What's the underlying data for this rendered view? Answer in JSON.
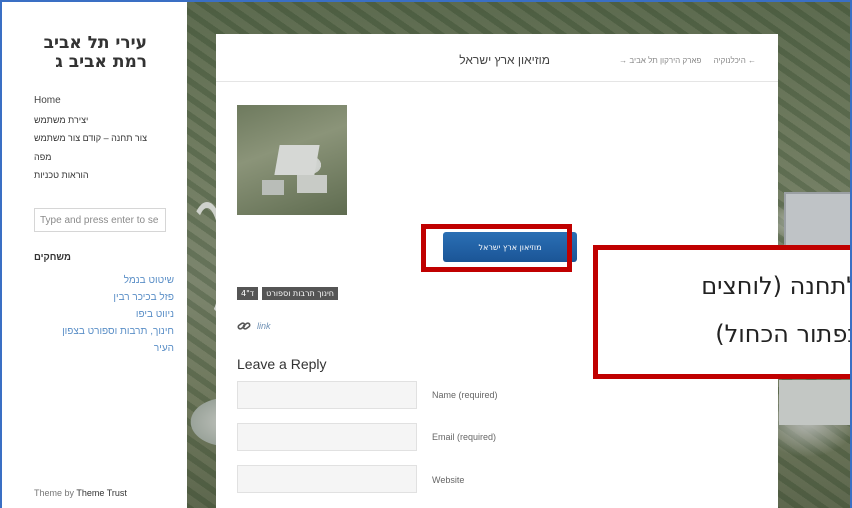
{
  "sidebar": {
    "site_title_line1": "עירי תל אביב",
    "site_title_line2": "רמת אביב ג",
    "nav": [
      "Home",
      "יצירת משתמש",
      "צור תחנה – קודם צור משתמש",
      "מפה",
      "הוראות טכניות"
    ],
    "search_placeholder": "Type and press enter to se",
    "widget_title": "משחקים",
    "games": [
      "שיטוט בנמל",
      "פזל בכיכר רבין",
      "ניווט ביפו",
      "חינוך, תרבות וספורט בצפון",
      "העיר"
    ],
    "footer_prefix": "Theme by",
    "footer_brand": "Theme Trust"
  },
  "post": {
    "title": "מוזיאון ארץ ישראל",
    "nav_prev": "← היכלנוקיה",
    "nav_next": "פארק הירקון תל אביב →",
    "button_label": "מוזיאון ארץ ישראל",
    "tags": [
      "ד\"4",
      "חינוך תרבות וספורט"
    ],
    "permalink_label": "link",
    "reply_title": "Leave a Reply",
    "fields": [
      "Name (required)",
      "Email (required)",
      "Website"
    ]
  },
  "callout": {
    "line1": "לתחנה (לוחצים",
    "line2": "כפתור הכחול)",
    "color": "#c00000"
  },
  "colors": {
    "accent_blue": "#1b5596",
    "link_blue": "#5b8fc7"
  }
}
